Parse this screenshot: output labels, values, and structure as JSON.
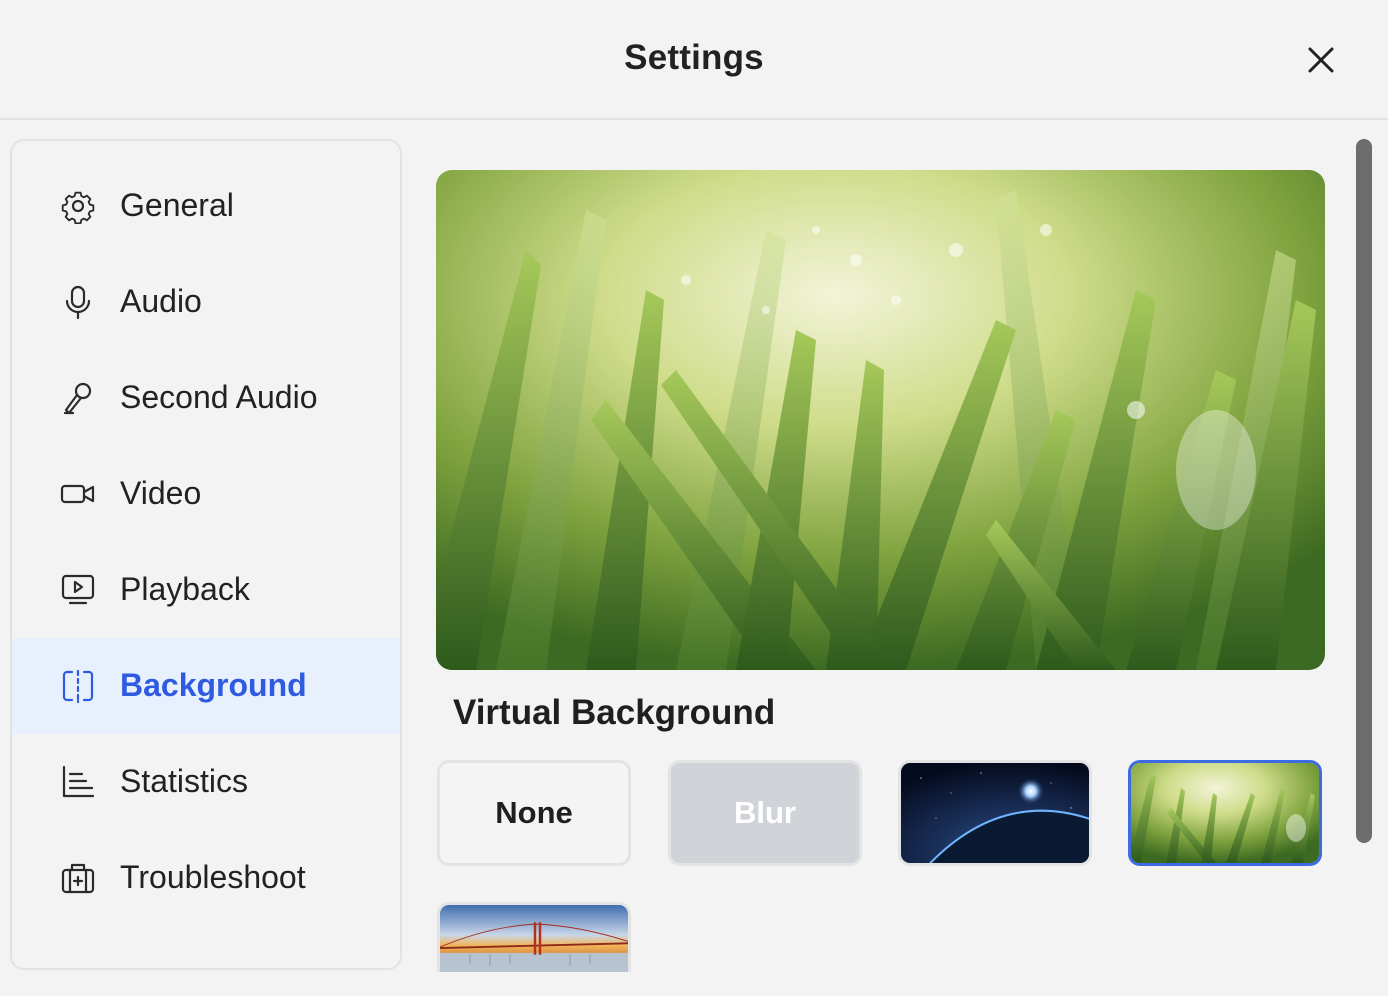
{
  "window": {
    "title": "Settings"
  },
  "sidebar": {
    "items": [
      {
        "label": "General",
        "icon": "gear-icon",
        "active": false
      },
      {
        "label": "Audio",
        "icon": "microphone-icon",
        "active": false
      },
      {
        "label": "Second Audio",
        "icon": "second-audio-icon",
        "active": false
      },
      {
        "label": "Video",
        "icon": "video-camera-icon",
        "active": false
      },
      {
        "label": "Playback",
        "icon": "playback-monitor-icon",
        "active": false
      },
      {
        "label": "Background",
        "icon": "background-split-icon",
        "active": true
      },
      {
        "label": "Statistics",
        "icon": "statistics-chart-icon",
        "active": false
      },
      {
        "label": "Troubleshoot",
        "icon": "toolbox-icon",
        "active": false
      }
    ]
  },
  "main": {
    "section_title": "Virtual Background",
    "options": [
      {
        "label": "None",
        "selected": false
      },
      {
        "label": "Blur",
        "selected": false
      },
      {
        "label": "",
        "thumbnail": "earth-from-space",
        "selected": false
      },
      {
        "label": "",
        "thumbnail": "grass-dew",
        "selected": true
      },
      {
        "label": "",
        "thumbnail": "golden-gate-bridge",
        "selected": false
      }
    ]
  },
  "colors": {
    "accent": "#2f5be0",
    "active_bg": "#e8f0fd",
    "selected_border": "#3c6be3"
  }
}
